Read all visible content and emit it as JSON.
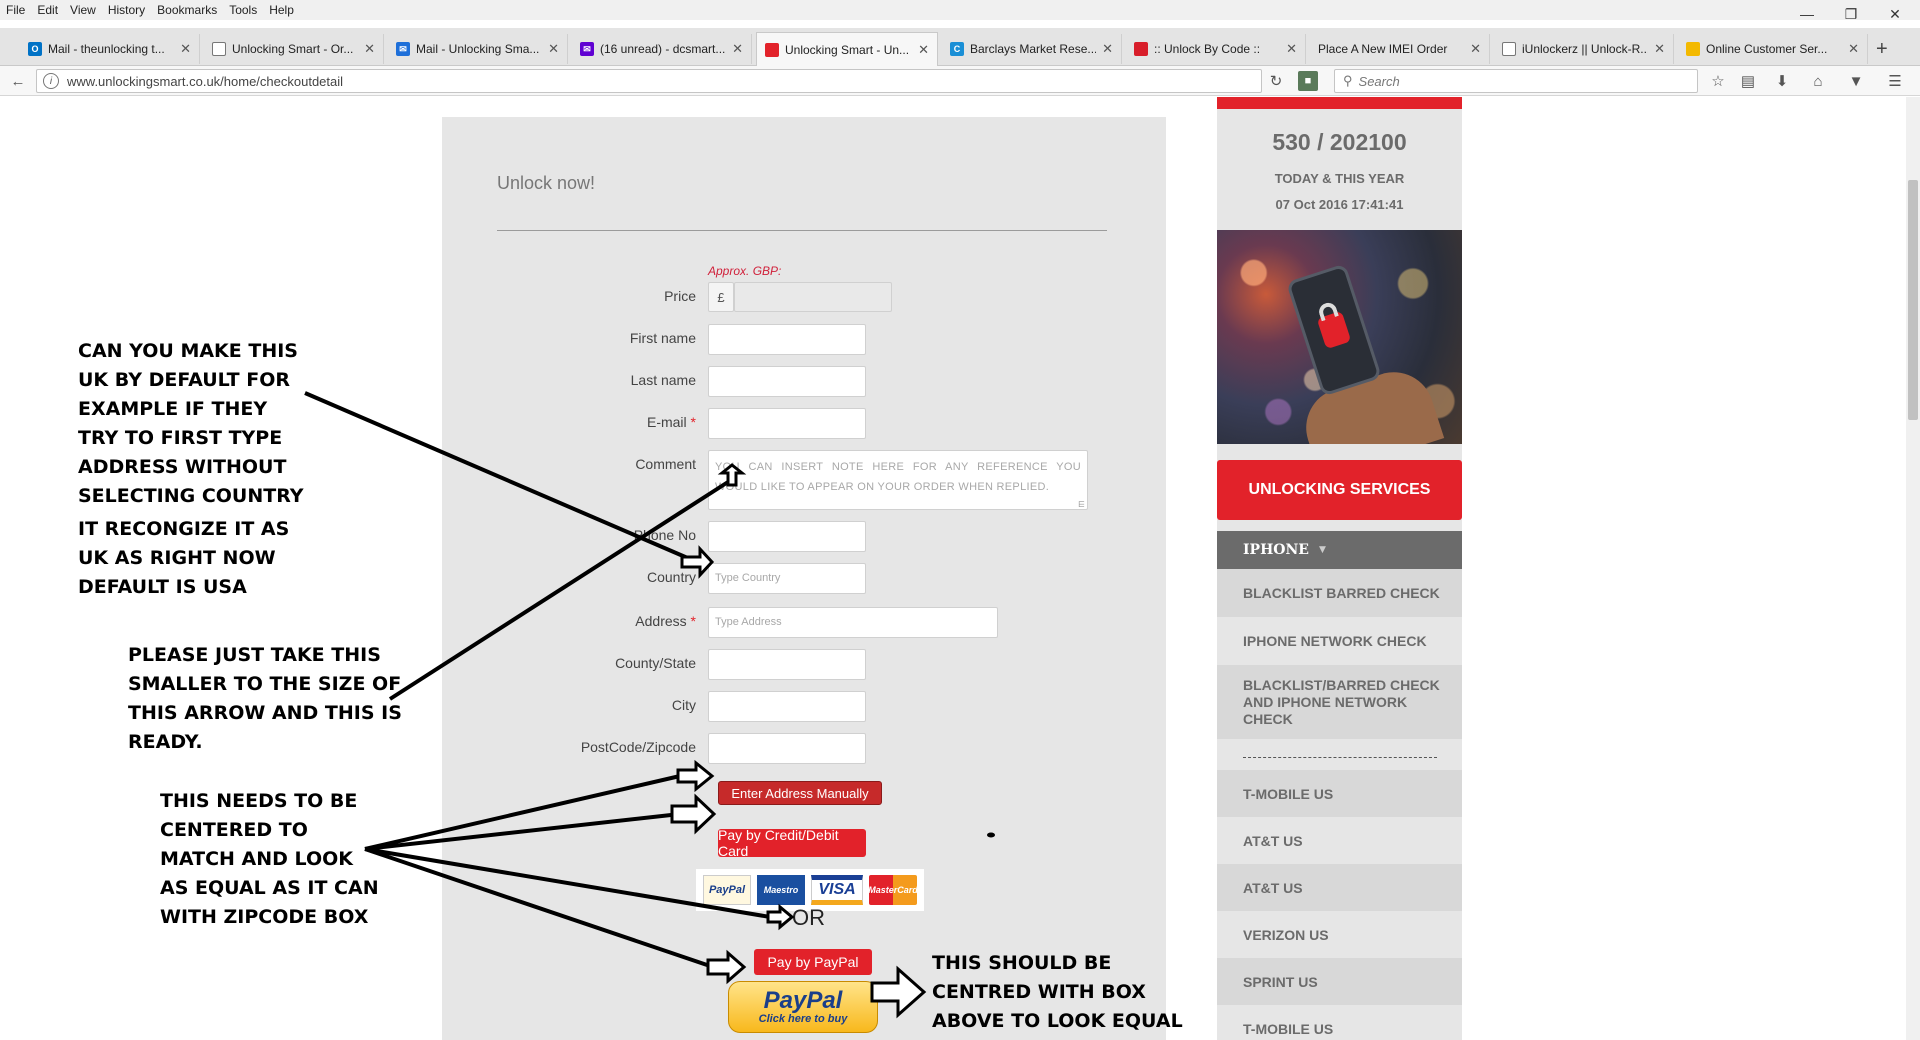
{
  "menubar": {
    "items": [
      "File",
      "Edit",
      "View",
      "History",
      "Bookmarks",
      "Tools",
      "Help"
    ]
  },
  "tabs": [
    {
      "label": "Mail - theunlocking t...",
      "fav": "O",
      "fav_color": "#0072c6"
    },
    {
      "label": "Unlocking Smart - Or...",
      "fav": "",
      "fav_color": "#e2222a"
    },
    {
      "label": "Mail - Unlocking Sma...",
      "fav": "",
      "fav_color": "#1e6fd9"
    },
    {
      "label": "(16 unread) - dcsmart...",
      "fav": "",
      "fav_color": "#6001d2"
    },
    {
      "label": "Unlocking Smart - Un...",
      "fav": "",
      "fav_color": "#e2222a"
    },
    {
      "label": "Barclays Market Rese...",
      "fav": "C",
      "fav_color": "#1a8fd6"
    },
    {
      "label": ":: Unlock By Code ::",
      "fav": "",
      "fav_color": "#d81e2a"
    },
    {
      "label": "Place A New IMEI Order",
      "fav": "",
      "fav_color": "#999999"
    },
    {
      "label": "iUnlockerz || Unlock-R...",
      "fav": "",
      "fav_color": "#555555"
    },
    {
      "label": "Online Customer Ser...",
      "fav": "",
      "fav_color": "#f3b900"
    }
  ],
  "navbar": {
    "url": "www.unlockingsmart.co.uk/home/checkoutdetail",
    "search_placeholder": "Search"
  },
  "form": {
    "title": "Unlock now!",
    "approx": "Approx. GBP:",
    "currency_symbol": "£",
    "labels": {
      "price": "Price",
      "first_name": "First name",
      "last_name": "Last name",
      "email": "E-mail",
      "comment": "Comment",
      "phone": "Phone No",
      "country": "Country",
      "address": "Address",
      "county": "County/State",
      "city": "City",
      "postcode": "PostCode/Zipcode"
    },
    "required_mark": "*",
    "comment_placeholder": "YOU CAN INSERT NOTE HERE FOR ANY REFERENCE YOU WOULD LIKE TO APPEAR ON YOUR ORDER WHEN REPLIED.",
    "country_placeholder": "Type Country",
    "address_placeholder": "Type Address",
    "enter_manually": "Enter Address Manually",
    "pay_card": "Pay by Credit/Debit Card",
    "card_logos": [
      "PayPal",
      "Maestro",
      "VISA",
      "MasterCard"
    ],
    "or": "OR",
    "pay_paypal": "Pay by PayPal",
    "paypal_logo": "PayPal",
    "paypal_sub": "Click here to buy"
  },
  "sidebar": {
    "counter": "530 / 202100",
    "counter_label": "TODAY & THIS YEAR",
    "timestamp": "07 Oct 2016 17:41:41",
    "services_button": "UNLOCKING SERVICES",
    "category": "IPHONE",
    "items": [
      "BLACKLIST BARRED CHECK",
      "IPHONE NETWORK CHECK",
      "BLACKLIST/BARRED CHECK AND IPHONE NETWORK CHECK",
      "T-MOBILE US",
      "AT&T US",
      "AT&T US",
      "VERIZON US",
      "SPRINT US",
      "T-MOBILE US"
    ]
  },
  "annotations": {
    "a1": "CAN YOU MAKE THIS\nUK BY DEFAULT FOR\nEXAMPLE IF THEY\nTRY TO FIRST TYPE\nADDRESS WITHOUT\nSELECTING COUNTRY",
    "a2": "IT RECONGIZE IT AS\nUK AS RIGHT NOW\nDEFAULT IS USA",
    "a3": "PLEASE JUST TAKE THIS\nSMALLER TO THE SIZE OF\nTHIS ARROW AND THIS IS\nREADY.",
    "a4": "THIS NEEDS TO BE\nCENTERED TO\nMATCH AND LOOK\nAS EQUAL AS IT CAN\nWITH ZIPCODE BOX",
    "a5": "THIS SHOULD BE\nCENTRED WITH BOX\nABOVE TO LOOK EQUAL"
  }
}
